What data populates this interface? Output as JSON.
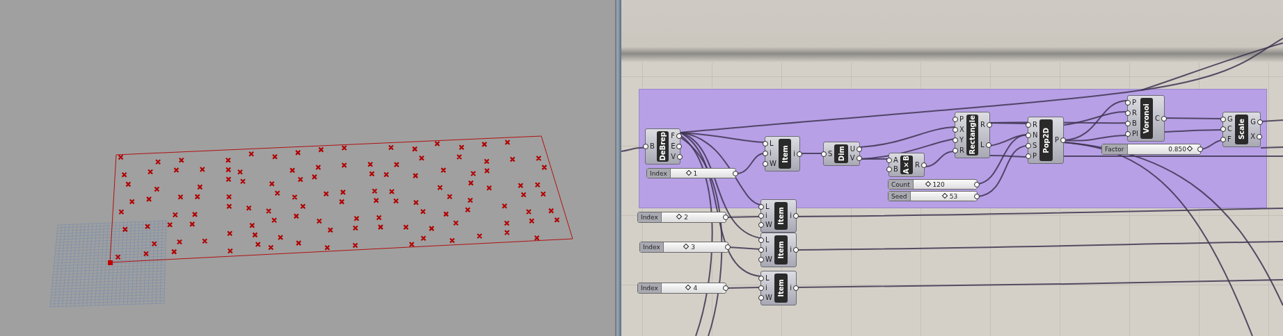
{
  "canvas": {
    "components": [
      {
        "name": "DeBrep",
        "inputs": [
          "B"
        ],
        "outputs": [
          "F",
          "E",
          "V"
        ]
      },
      {
        "name": "Item",
        "inputs": [
          "L",
          "i",
          "W"
        ],
        "outputs": [
          "i"
        ]
      },
      {
        "name": "Dim",
        "inputs": [
          "S"
        ],
        "outputs": [
          "U",
          "V"
        ]
      },
      {
        "name": "A×B",
        "inputs": [
          "A",
          "B"
        ],
        "outputs": [
          "R"
        ]
      },
      {
        "name": "Rectangle",
        "inputs": [
          "P",
          "X",
          "Y",
          "R"
        ],
        "outputs": [
          "R",
          "L"
        ]
      },
      {
        "name": "Pop2D",
        "inputs": [
          "R",
          "N",
          "S",
          "P"
        ],
        "outputs": [
          "P"
        ]
      },
      {
        "name": "Voronoi",
        "inputs": [
          "P",
          "R",
          "B",
          "Pl"
        ],
        "outputs": [
          "C"
        ]
      },
      {
        "name": "Scale",
        "inputs": [
          "G",
          "C",
          "F"
        ],
        "outputs": [
          "G",
          "X"
        ]
      },
      {
        "name": "Item",
        "inputs": [
          "L",
          "i",
          "W"
        ],
        "outputs": [
          "i"
        ]
      },
      {
        "name": "Item",
        "inputs": [
          "L",
          "i",
          "W"
        ],
        "outputs": [
          "i"
        ]
      },
      {
        "name": "Item",
        "inputs": [
          "L",
          "i",
          "W"
        ],
        "outputs": [
          "i"
        ]
      }
    ],
    "sliders": [
      {
        "label": "Index",
        "value": "1",
        "level": 0.3
      },
      {
        "label": "Count",
        "value": "120",
        "level": 0.25
      },
      {
        "label": "Seed",
        "value": "53",
        "level": 0.55
      },
      {
        "label": "Factor",
        "value": "0.850",
        "level": 0.9
      },
      {
        "label": "Index",
        "value": "2",
        "level": 0.3
      },
      {
        "label": "Index",
        "value": "3",
        "level": 0.38
      },
      {
        "label": "Index",
        "value": "4",
        "level": 0.45
      }
    ]
  }
}
